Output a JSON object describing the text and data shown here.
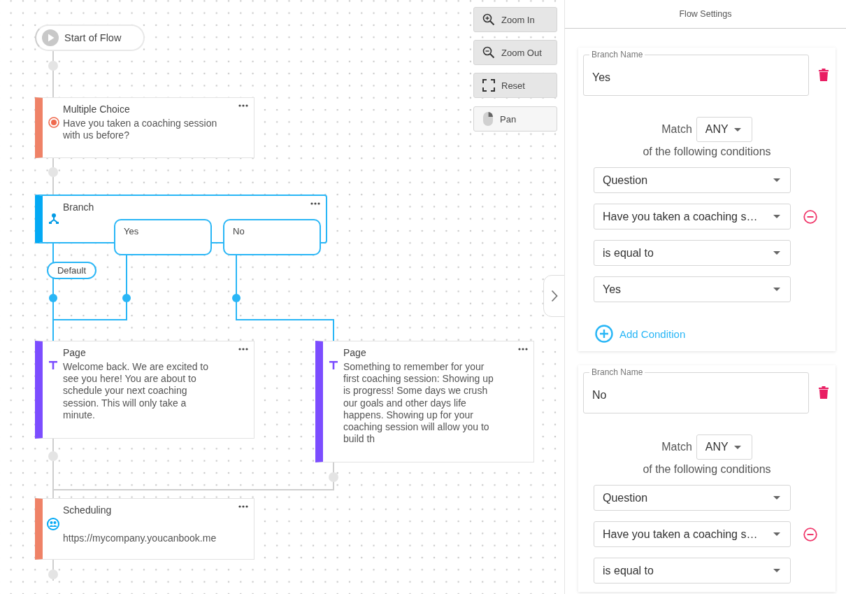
{
  "canvas": {
    "nodes": [
      {
        "kind": "start",
        "title": "Start of Flow"
      },
      {
        "kind": "multiple_choice",
        "title": "Multiple Choice",
        "text": "Have you taken a coaching session with us before?"
      },
      {
        "kind": "branch",
        "title": "Branch",
        "branches": [
          "Yes",
          "No"
        ],
        "default_label": "Default"
      },
      {
        "kind": "page",
        "title": "Page",
        "text": "Welcome back. We are excited to see you here! You are about to schedule your next coaching session. This will only take a minute."
      },
      {
        "kind": "page",
        "title": "Page",
        "text": "Something to remember for your first coaching session: Showing up is progress! Some days we crush our goals and other days life happens. Showing up for your coaching session will allow you to build th"
      },
      {
        "kind": "scheduling",
        "title": "Scheduling",
        "text": "https://mycompany.youcanbook.me"
      }
    ],
    "controls": [
      {
        "kind": "zoom_in",
        "label": "Zoom In"
      },
      {
        "kind": "zoom_out",
        "label": "Zoom Out"
      },
      {
        "kind": "reset",
        "label": "Reset"
      },
      {
        "kind": "pan",
        "label": "Pan"
      }
    ]
  },
  "panel": {
    "title": "Flow Settings",
    "branches": [
      {
        "name_label": "Branch Name",
        "name": "Yes",
        "match_label": "Match",
        "match": "ANY",
        "following": "of the following conditions",
        "conditions": [
          {
            "value": "Question",
            "removable": false
          },
          {
            "value": "Have you taken a coaching s…",
            "removable": true
          },
          {
            "value": "is equal to",
            "removable": false
          },
          {
            "value": "Yes",
            "removable": false
          }
        ],
        "add_label": "Add Condition"
      },
      {
        "name_label": "Branch Name",
        "name": "No",
        "match_label": "Match",
        "match": "ANY",
        "following": "of the following conditions",
        "conditions": [
          {
            "value": "Question",
            "removable": false
          },
          {
            "value": "Have you taken a coaching s…",
            "removable": true
          },
          {
            "value": "is equal to",
            "removable": false
          }
        ]
      }
    ]
  }
}
